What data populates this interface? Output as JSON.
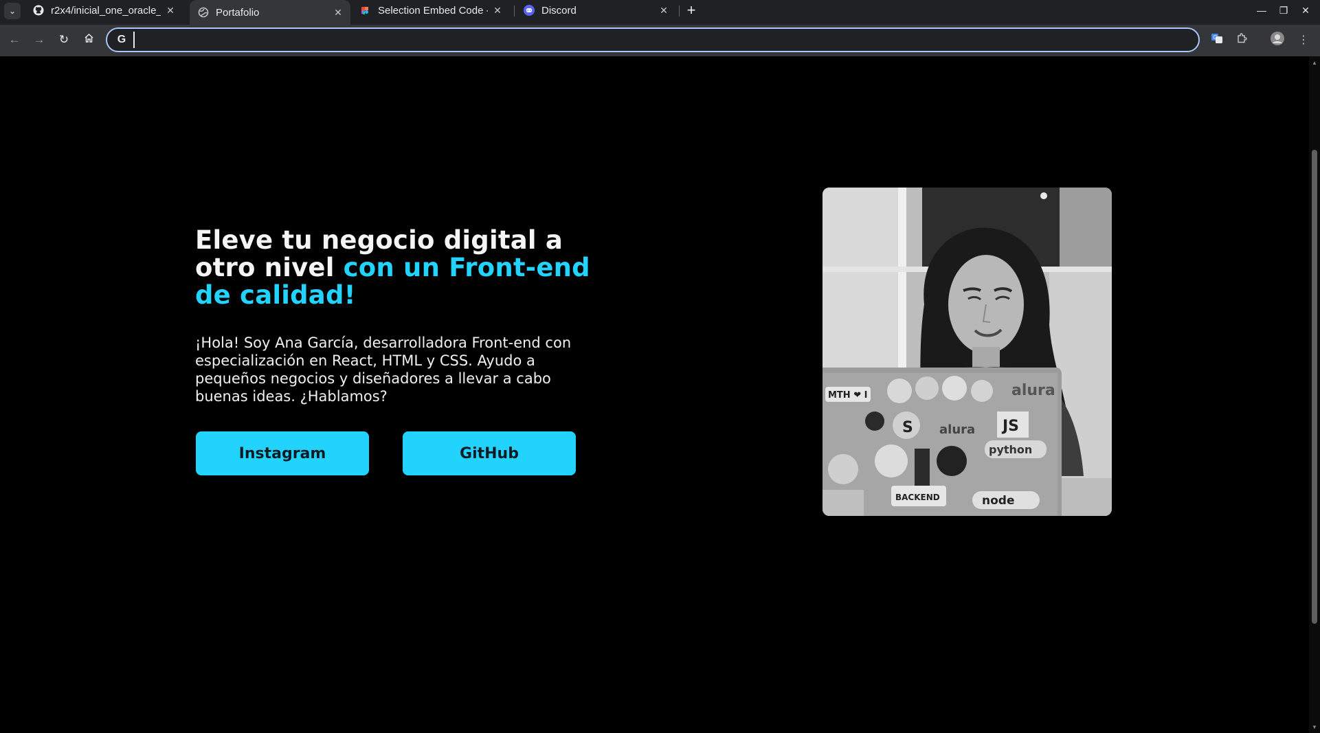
{
  "browser": {
    "tabs": [
      {
        "title": "r2x4/inicial_one_oracle_",
        "favicon": "github-icon",
        "active": false
      },
      {
        "title": "Portafolio",
        "favicon": "globe-icon",
        "active": true
      },
      {
        "title": "Selection Embed Code - ",
        "favicon": "figma-icon",
        "active": false
      },
      {
        "title": "Discord",
        "favicon": "discord-icon",
        "active": false
      }
    ],
    "omnibox": {
      "value": "",
      "placeholder": ""
    },
    "accent_color": "#a8c7fa"
  },
  "page": {
    "title_part1": "Eleve tu negocio digital a otro nivel ",
    "title_accent": "con un Front-end de calidad!",
    "description": "¡Hola! Soy Ana García, desarrolladora Front-end con especialización en React, HTML y CSS. Ayudo a pequeños negocios y diseñadores a llevar a cabo buenas ideas. ¿Hablamos?",
    "buttons": [
      {
        "label": "Instagram"
      },
      {
        "label": "GitHub"
      }
    ],
    "accent_color": "#22d4fd",
    "background_color": "#000000",
    "photo_stickers": [
      "MTH ❤ I",
      "alura",
      "JS",
      "python",
      "alura",
      "BACKEND",
      "node"
    ]
  }
}
